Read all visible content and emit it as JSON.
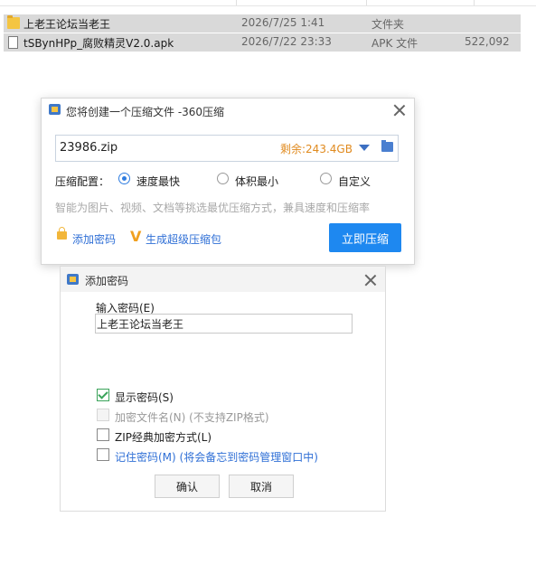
{
  "files": [
    {
      "name": "上老王论坛当老王",
      "date": "2026/7/25 1:41",
      "type": "文件夹",
      "size": "",
      "icon": "folder-icon"
    },
    {
      "name": "tSBynHPp_腐败精灵V2.0.apk",
      "date": "2026/7/22 23:33",
      "type": "APK 文件",
      "size": "522,092",
      "icon": "file-icon"
    }
  ],
  "compress_dialog": {
    "title": "您将创建一个压缩文件 -360压缩",
    "filename": "23986.zip",
    "free_space": "剩余:243.4GB",
    "config_label": "压缩配置：",
    "options": [
      "速度最快",
      "体积最小",
      "自定义"
    ],
    "selected_option": "速度最快",
    "hint": "智能为图片、视频、文档等挑选最优压缩方式，兼具速度和压缩率",
    "add_password": "添加密码",
    "sfx": "生成超级压缩包",
    "compress_now": "立即压缩",
    "accent_color": "#1e88f0"
  },
  "password_dialog": {
    "title": "添加密码",
    "input_label": "输入密码(E)",
    "password_value": "上老王论坛当老王",
    "checkboxes": [
      {
        "label": "显示密码(S)",
        "checked": true,
        "disabled": false
      },
      {
        "label": "加密文件名(N) (不支持ZIP格式)",
        "checked": false,
        "disabled": true
      },
      {
        "label": "ZIP经典加密方式(L)",
        "checked": false,
        "disabled": false
      },
      {
        "label": "记住密码(M) (将会备忘到密码管理窗口中)",
        "checked": false,
        "disabled": false
      }
    ],
    "ok": "确认",
    "cancel": "取消"
  }
}
